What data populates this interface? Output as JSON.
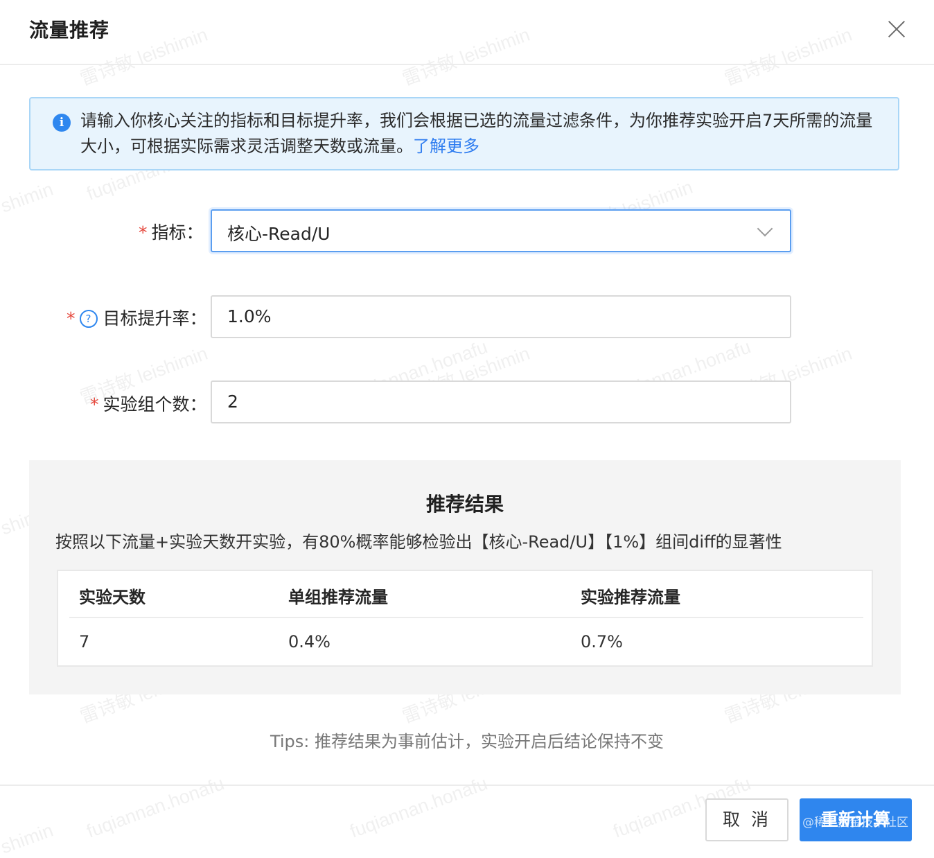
{
  "dialog": {
    "title": "流量推荐",
    "close_icon": "close-icon"
  },
  "alert": {
    "icon": "info-icon",
    "text": "请输入你核心关注的指标和目标提升率，我们会根据已选的流量过滤条件，为你推荐实验开启7天所需的流量大小，可根据实际需求灵活调整天数或流量。",
    "link": "了解更多"
  },
  "form": {
    "required_mark": "*",
    "metric": {
      "label": "指标：",
      "value": "核心-Read/U"
    },
    "target_rate": {
      "label": "目标提升率：",
      "value": "1.0%",
      "help_icon": "?"
    },
    "group_count": {
      "label": "实验组个数：",
      "value": "2"
    }
  },
  "result": {
    "title": "推荐结果",
    "description": "按照以下流量+实验天数开实验，有80%概率能够检验出【核心-Read/U】【1%】组间diff的显著性",
    "columns": [
      "实验天数",
      "单组推荐流量",
      "实验推荐流量"
    ],
    "rows": [
      [
        "7",
        "0.4%",
        "0.7%"
      ]
    ]
  },
  "tips": "Tips: 推荐结果为事前估计，实验开启后结论保持不变",
  "footer": {
    "cancel_label": "取 消",
    "recalc_label": "重新计算",
    "corner_watermark": "@稀土掘金技术社区"
  },
  "watermarks": {
    "name": "雷诗敏 leishimin",
    "domain": "fuqiannan.honafu",
    "short": "shimin"
  },
  "colors": {
    "primary": "#2f86ee",
    "link": "#2f7df0",
    "required": "#e5463b",
    "alert_bg": "#e8f4fd",
    "alert_border": "#a9d6f7",
    "panel_bg": "#f4f4f4"
  }
}
